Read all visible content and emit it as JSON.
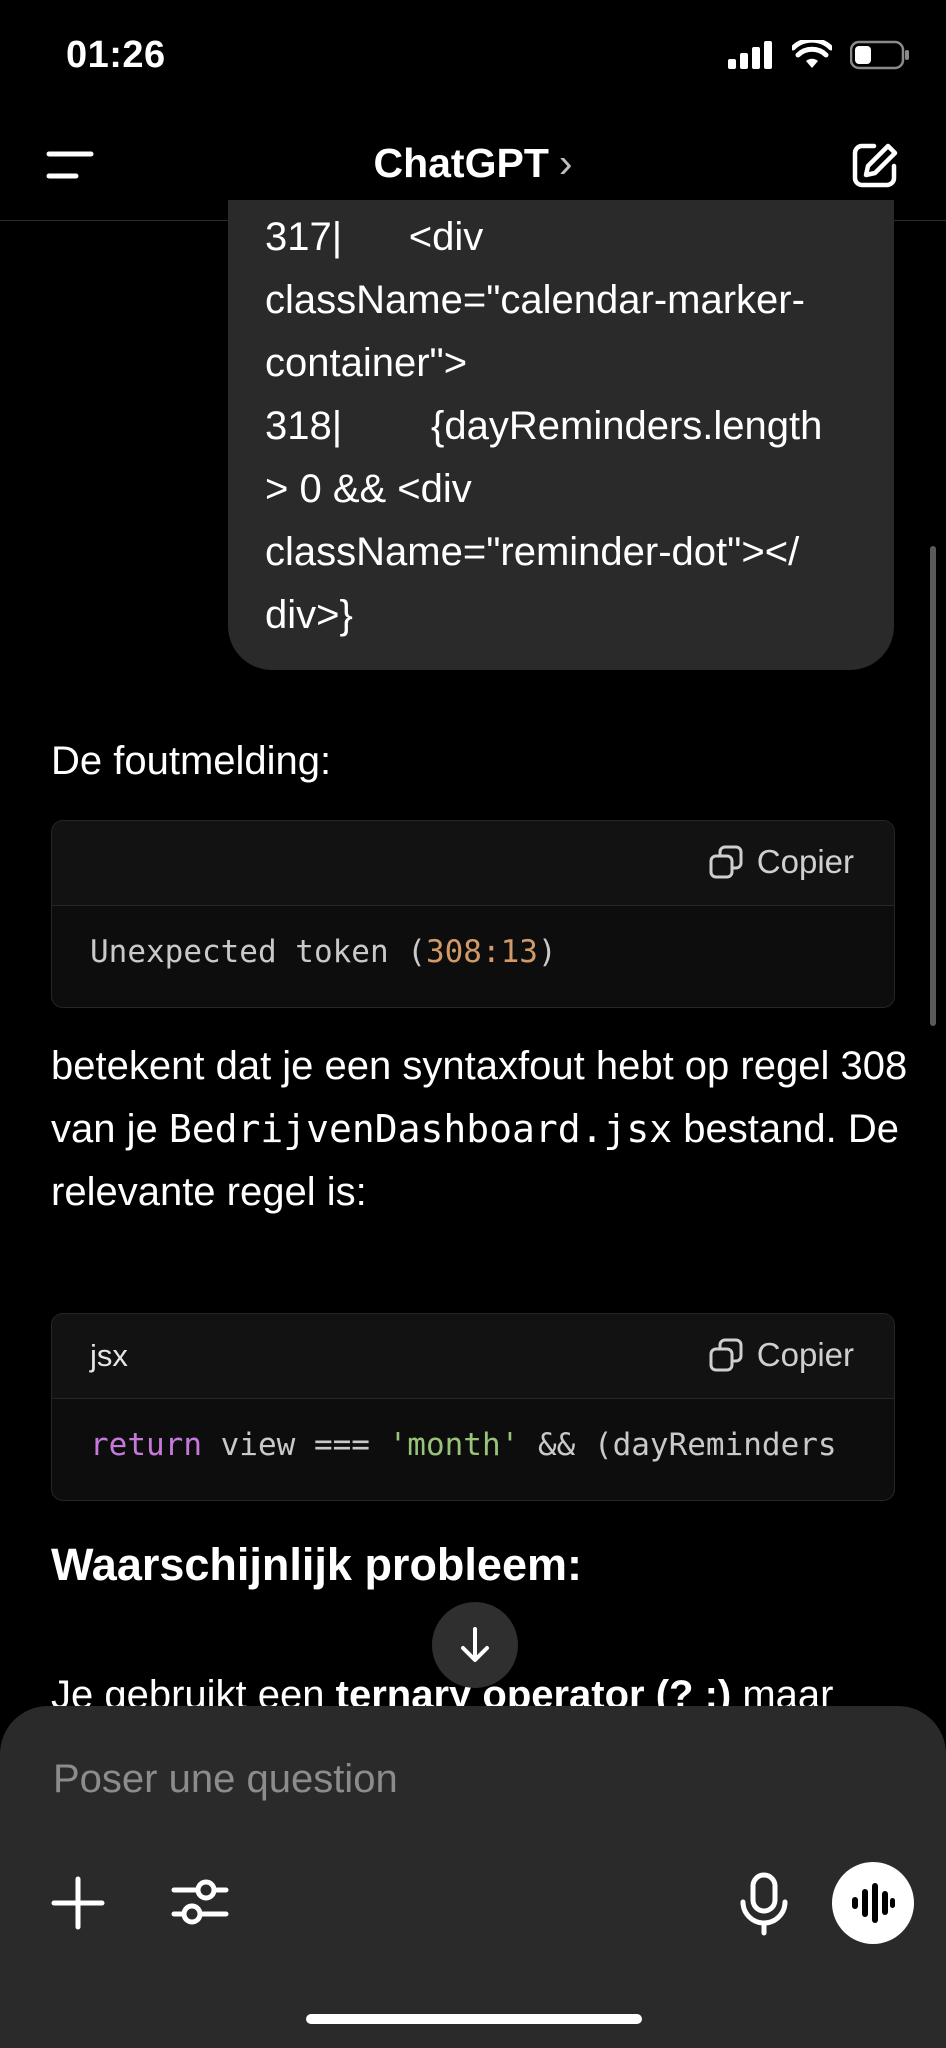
{
  "status_bar": {
    "time": "01:26"
  },
  "header": {
    "title": "ChatGPT",
    "title_chevron": "›"
  },
  "user_message": {
    "text": "317|      <div\nclassName=\"calendar-marker-\ncontainer\">\n318|        {dayReminders.length\n> 0 && <div\nclassName=\"reminder-dot\"></\ndiv>}"
  },
  "assistant": {
    "intro": "De foutmelding:",
    "code1": {
      "lang": "",
      "copy_label": "Copier",
      "code_prefix": "Unexpected token (",
      "code_number": "308:13",
      "code_suffix": ")"
    },
    "para": {
      "part1": "betekent dat je een syntaxfout hebt op regel 308 van je ",
      "filename": "BedrijvenDashboard.jsx",
      "part2": " bestand. De relevante regel is:"
    },
    "code2": {
      "lang": "jsx",
      "copy_label": "Copier",
      "kw": "return",
      "t1": " view === ",
      "str": "'month'",
      "t2": " && (dayReminders"
    },
    "heading": "Waarschijnlijk probleem:",
    "cut": {
      "part1": "Je gebruikt een ",
      "bold": "ternary operator (? :)",
      "part2": " maar"
    }
  },
  "composer": {
    "placeholder": "Poser une question"
  },
  "icons": {
    "menu": "menu-icon",
    "edit": "edit-icon",
    "copy": "copy-icon",
    "arrow_down": "arrow-down-icon",
    "plus": "plus-icon",
    "tools": "sliders-icon",
    "mic": "microphone-icon",
    "voice": "voice-wave-icon"
  }
}
